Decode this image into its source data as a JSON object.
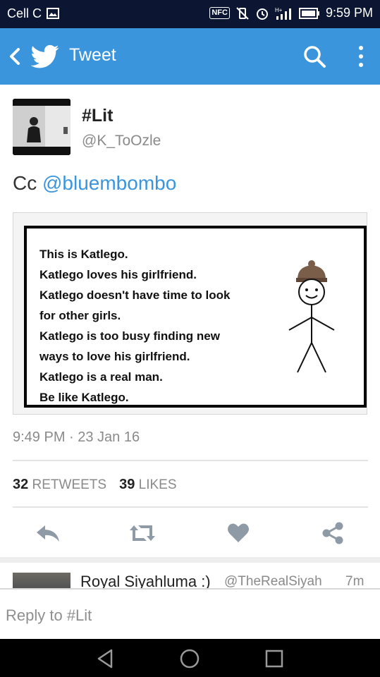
{
  "status_bar": {
    "carrier": "Cell C",
    "nfc": "NFC",
    "time": "9:59 PM"
  },
  "app_bar": {
    "title": "Tweet"
  },
  "tweet": {
    "name": "#Lit",
    "handle": "@K_ToOzle",
    "text_prefix": "Cc ",
    "mention": "@bluembombo",
    "image_lines": [
      "This is Katlego.",
      "Katlego loves his girlfriend.",
      "Katlego doesn't have time to look",
      "for other girls.",
      "Katlego is too busy finding new",
      "ways to love his girlfriend.",
      "Katlego is a real man.",
      "Be like Katlego."
    ],
    "timestamp": "9:49 PM · 23 Jan 16",
    "retweets_count": "32",
    "retweets_label": "RETWEETS",
    "likes_count": "39",
    "likes_label": "LIKES"
  },
  "next_tweet": {
    "name": "Royal Siyahluma :)",
    "handle": "@TheRealSiyah",
    "time": "7m"
  },
  "reply": {
    "placeholder": "Reply to #Lit"
  },
  "icons": {
    "back": "chevron-left-icon",
    "logo": "twitter-bird-icon",
    "search": "search-icon",
    "more": "more-vert-icon",
    "reply": "reply-icon",
    "retweet": "retweet-icon",
    "like": "heart-icon",
    "share": "share-icon"
  },
  "colors": {
    "accent": "#3b95dc",
    "status_bar": "#0c1633",
    "muted_text": "#8a8a8a"
  }
}
